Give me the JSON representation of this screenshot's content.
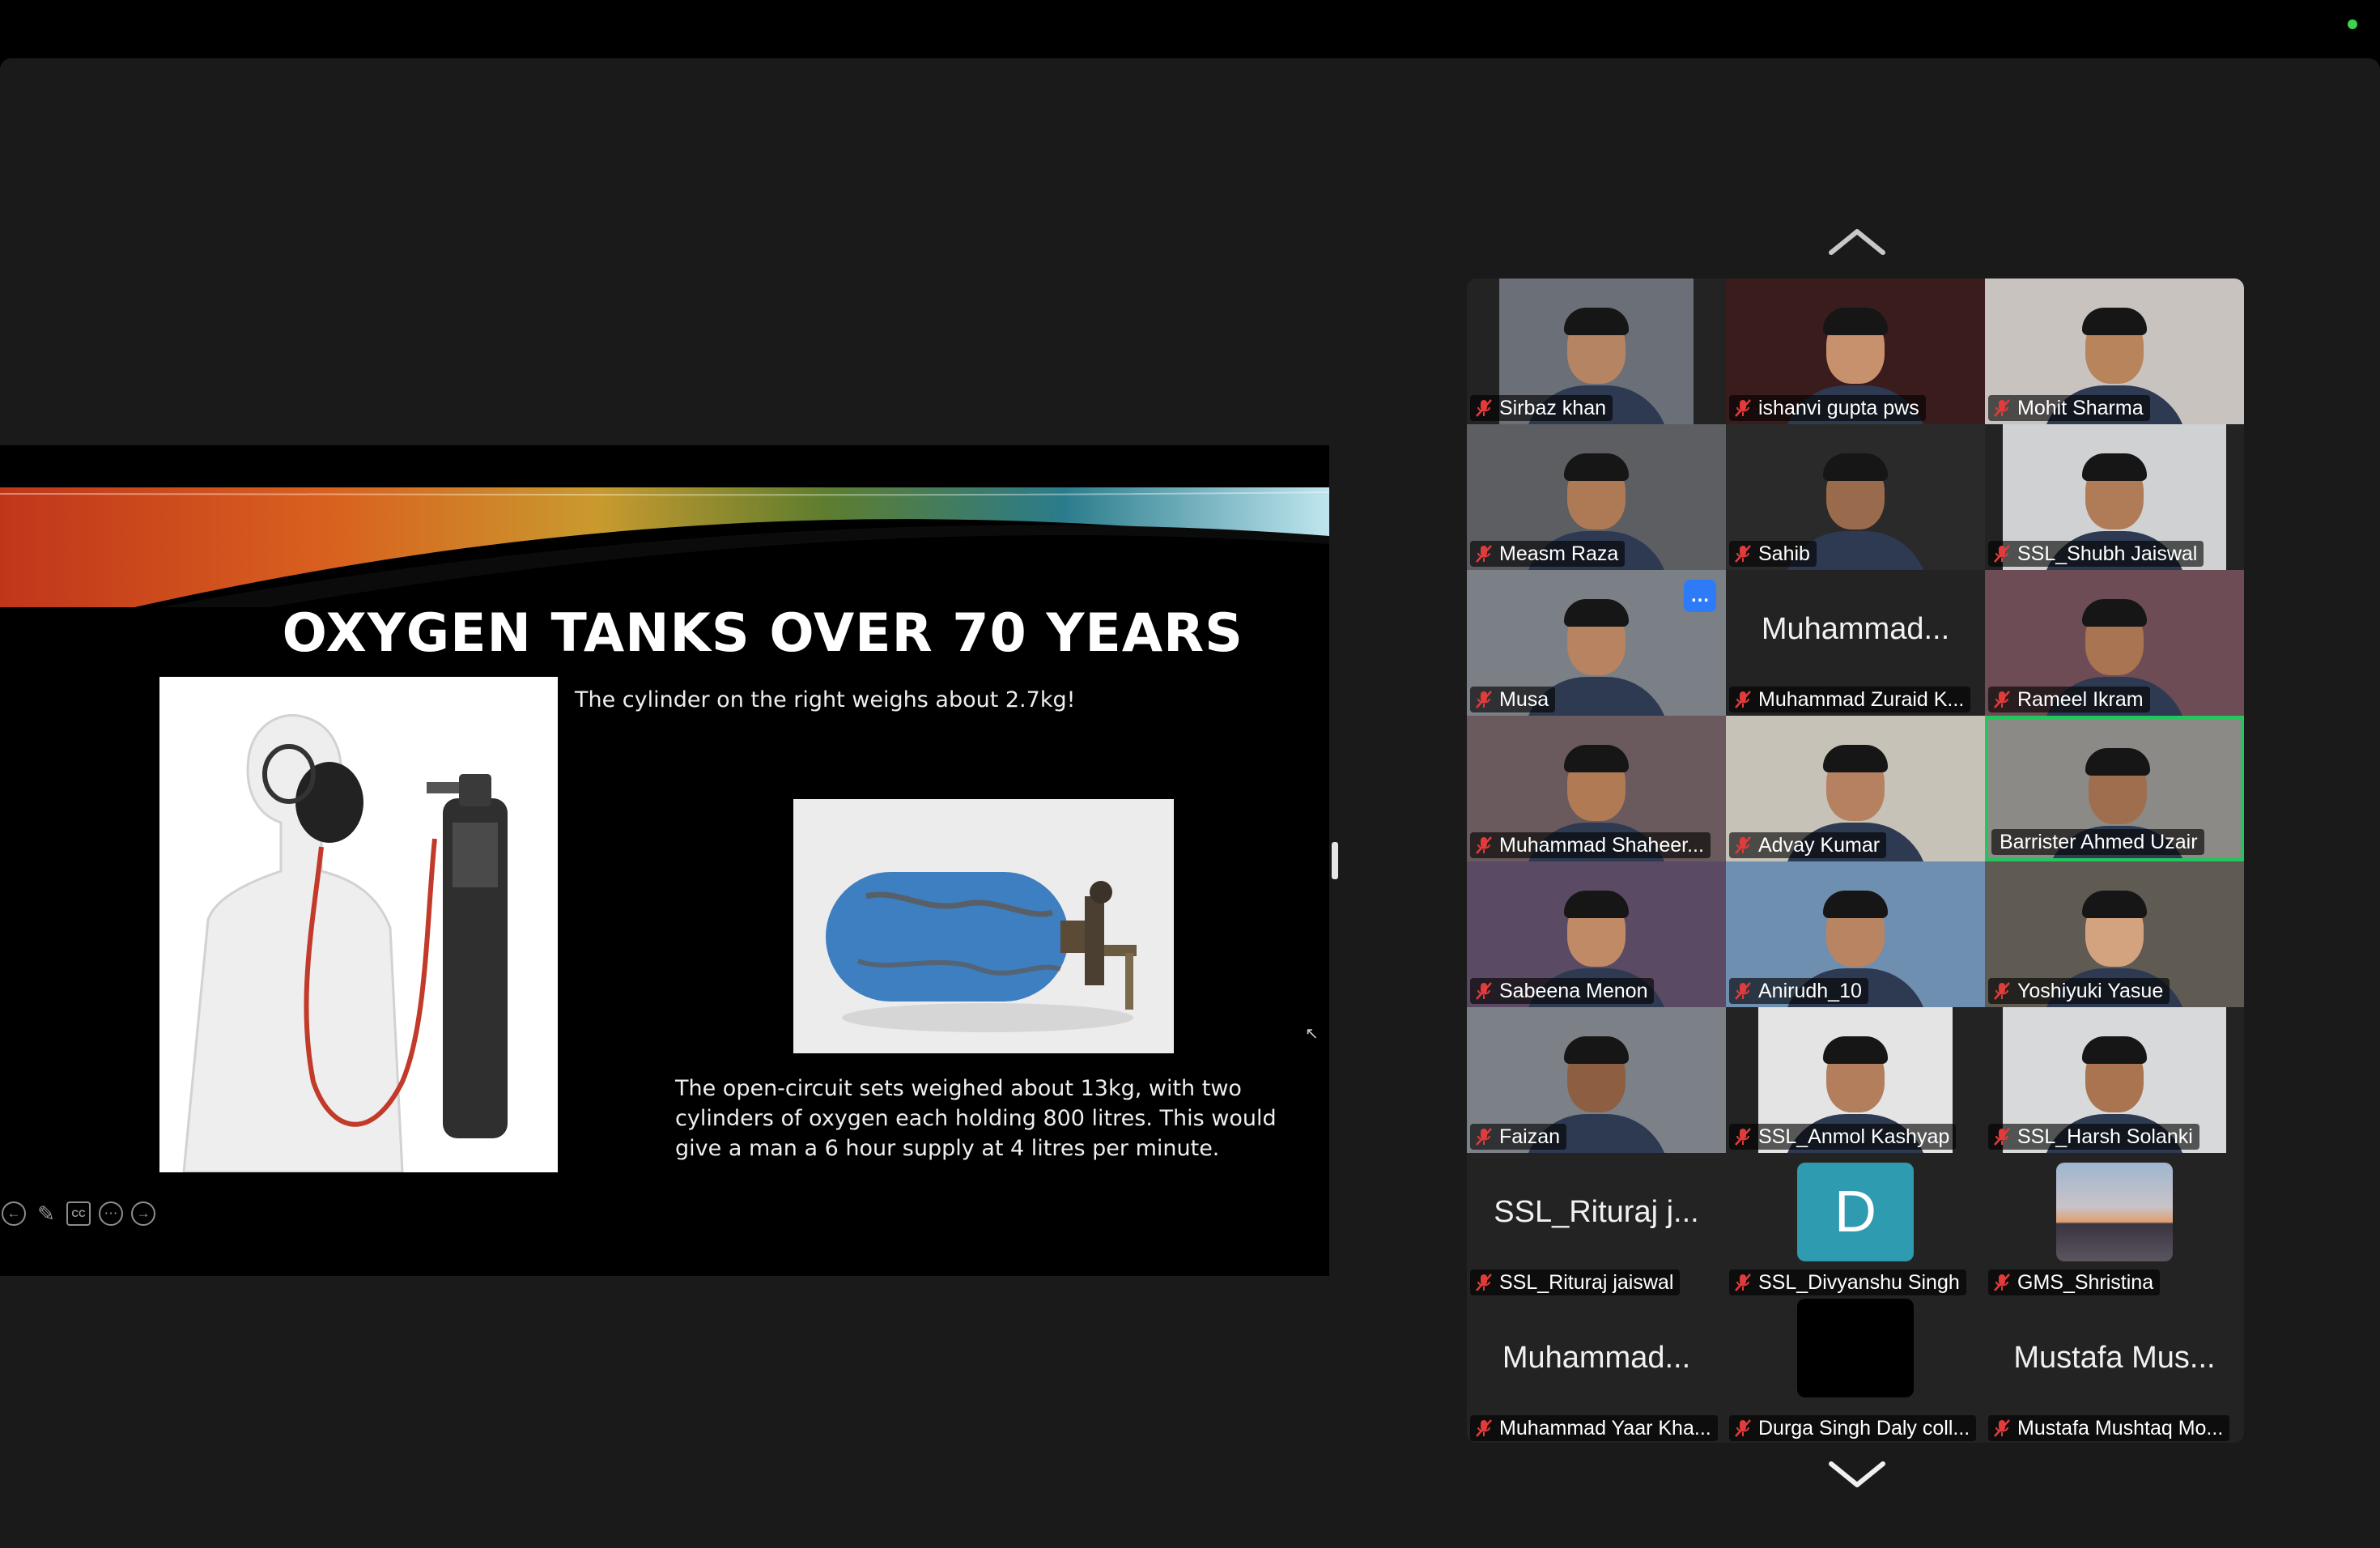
{
  "slide": {
    "title": "OXYGEN TANKS OVER 70 YEARS",
    "caption_top": "The cylinder on the right weighs about 2.7kg!",
    "caption_bottom": "The open-circuit sets weighed about 13kg, with two cylinders of oxygen each holding 800 litres. This would give a man a 6 hour supply at 4 litres per minute.",
    "controls": {
      "prev_icon": "arrow-left-circle-icon",
      "pen_icon": "pen-icon",
      "cc_label": "CC",
      "more_icon": "ellipsis-circle-icon",
      "next_icon": "arrow-right-circle-icon"
    }
  },
  "gallery": {
    "scroll_up_icon": "chevron-up-icon",
    "scroll_down_icon": "chevron-down-icon",
    "accent_active": "#22c55e",
    "muted_icon": "mic-muted-icon",
    "participants": [
      {
        "name": "Sirbaz khan",
        "muted": true,
        "video": true
      },
      {
        "name": "ishanvi gupta pws",
        "muted": true,
        "video": true
      },
      {
        "name": "Mohit Sharma",
        "muted": true,
        "video": true
      },
      {
        "name": "Measm Raza",
        "muted": true,
        "video": true
      },
      {
        "name": "Sahib",
        "muted": true,
        "video": true
      },
      {
        "name": "SSL_Shubh Jaiswal",
        "muted": true,
        "video": true
      },
      {
        "name": "Musa",
        "muted": true,
        "video": true,
        "more_menu": "…"
      },
      {
        "name": "Muhammad Zuraid K...",
        "muted": true,
        "video": false,
        "display_name": "Muhammad..."
      },
      {
        "name": "Rameel Ikram",
        "muted": true,
        "video": true
      },
      {
        "name": "Muhammad Shaheer...",
        "muted": true,
        "video": true
      },
      {
        "name": "Advay Kumar",
        "muted": true,
        "video": true
      },
      {
        "name": "Barrister Ahmed Uzair",
        "muted": false,
        "video": true,
        "active_speaker": true
      },
      {
        "name": "Sabeena Menon",
        "muted": true,
        "video": true
      },
      {
        "name": "Anirudh_10",
        "muted": true,
        "video": true
      },
      {
        "name": "Yoshiyuki Yasue",
        "muted": true,
        "video": true
      },
      {
        "name": "Faizan",
        "muted": true,
        "video": true
      },
      {
        "name": "SSL_Anmol Kashyap",
        "muted": true,
        "video": true
      },
      {
        "name": "SSL_Harsh Solanki",
        "muted": true,
        "video": true
      },
      {
        "name": "SSL_Rituraj jaiswal",
        "muted": true,
        "video": false,
        "display_name": "SSL_Rituraj j..."
      },
      {
        "name": "SSL_Divyanshu Singh",
        "muted": true,
        "video": false,
        "avatar_letter": "D",
        "avatar_color": "#2e9bb0"
      },
      {
        "name": "GMS_Shristina",
        "muted": true,
        "video": false,
        "avatar_photo": "sunset"
      },
      {
        "name": "Muhammad Yaar Kha...",
        "muted": true,
        "video": false,
        "display_name": "Muhammad..."
      },
      {
        "name": "Durga Singh Daly coll...",
        "muted": true,
        "video": false,
        "avatar_blank": true
      },
      {
        "name": "Mustafa Mushtaq Mo...",
        "muted": true,
        "video": false,
        "display_name": "Mustafa Mus..."
      }
    ]
  }
}
